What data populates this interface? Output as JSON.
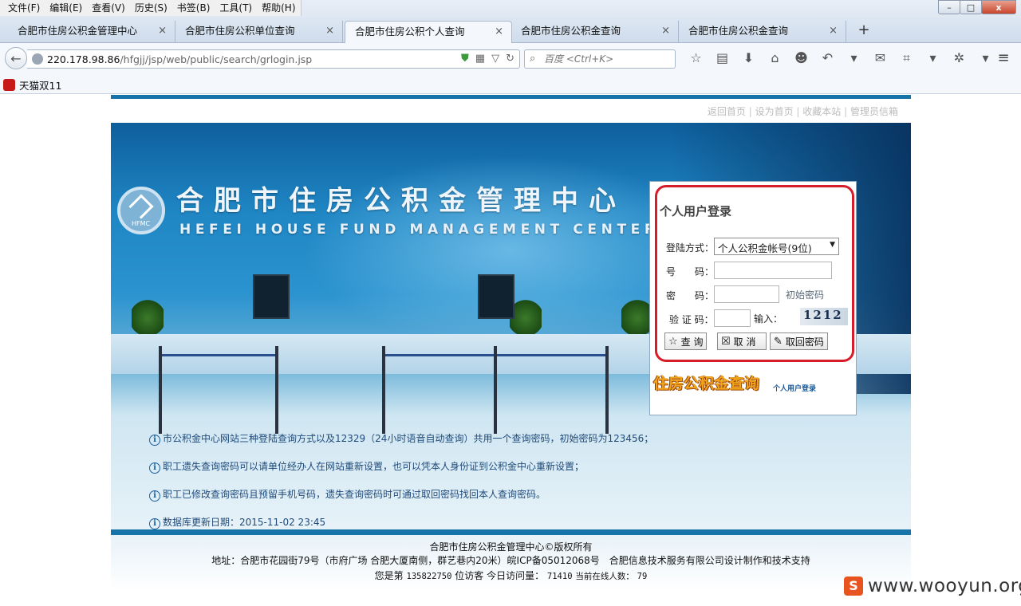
{
  "menubar": [
    "文件(F)",
    "编辑(E)",
    "查看(V)",
    "历史(S)",
    "书签(B)",
    "工具(T)",
    "帮助(H)"
  ],
  "window_controls": [
    "–",
    "□",
    "x"
  ],
  "tabs": [
    {
      "label": "合肥市住房公积金管理中心",
      "active": false
    },
    {
      "label": "合肥市住房公积单位查询",
      "active": false
    },
    {
      "label": "合肥市住房公积个人查询",
      "active": true
    },
    {
      "label": "合肥市住房公积金查询",
      "active": false
    },
    {
      "label": "合肥市住房公积金查询",
      "active": false
    }
  ],
  "tab_close": "×",
  "new_tab": "+",
  "nav": {
    "url_host": "220.178.98.86",
    "url_path": "/hfgjj/jsp/web/public/search/grlogin.jsp",
    "search_placeholder": "百度 <Ctrl+K>"
  },
  "bookmarks": [
    {
      "label": "天猫双11"
    }
  ],
  "page": {
    "top_links": [
      "返回首页",
      "设为首页",
      "收藏本站",
      "管理员信箱"
    ],
    "banner_title": "合肥市住房公积金管理中心",
    "banner_subtitle": "HEFEI HOUSE FUND MANAGEMENT CENTER",
    "logo_text": "HFMC",
    "login": {
      "title": "个人用户登录",
      "method_label": "登陆方式：",
      "method_value": "个人公积金帐号(9位)",
      "number_label": "号　　码：",
      "number_value": "",
      "password_label": "密　　码：",
      "password_value": "",
      "initial_password_link": "初始密码",
      "captcha_label": "验 证 码：",
      "captcha_value": "",
      "captcha_input_label": "输入：",
      "captcha_image_text": "1212",
      "buttons": {
        "query": "查 询",
        "cancel": "取 消",
        "retrieve": "取回密码"
      },
      "brand_text": "住房公积金查询",
      "brand_sub": "个人用户登录"
    },
    "notices": [
      "市公积金中心网站三种登陆查询方式以及12329（24小时语音自动查询）共用一个查询密码，初始密码为123456；",
      "职工遗失查询密码可以请单位经办人在网站重新设置，也可以凭本人身份证到公积金中心重新设置；",
      "职工已修改查询密码且预留手机号码，遗失查询密码时可通过取回密码找回本人查询密码。",
      "数据库更新日期：2015-11-02 23:45"
    ],
    "footer": {
      "copyright": "合肥市住房公积金管理中心©版权所有",
      "address": "地址：合肥市花园街79号（市府广场 合肥大厦南侧，群艺巷内20米）皖ICP备05012068号　合肥信息技术服务有限公司设计制作和技术支持",
      "visitor_prefix": "您是第",
      "visitor_count": "135822750",
      "visitor_mid": "位访客 今日访问量：",
      "today_count": "71410",
      "online_label": "当前在线人数：",
      "online_count": "79"
    }
  },
  "watermark": "www.wooyun.org",
  "colors": {
    "accent_blue": "#1774a9",
    "frame_red": "#d61d2a",
    "brand_orange": "#f0a41a"
  }
}
